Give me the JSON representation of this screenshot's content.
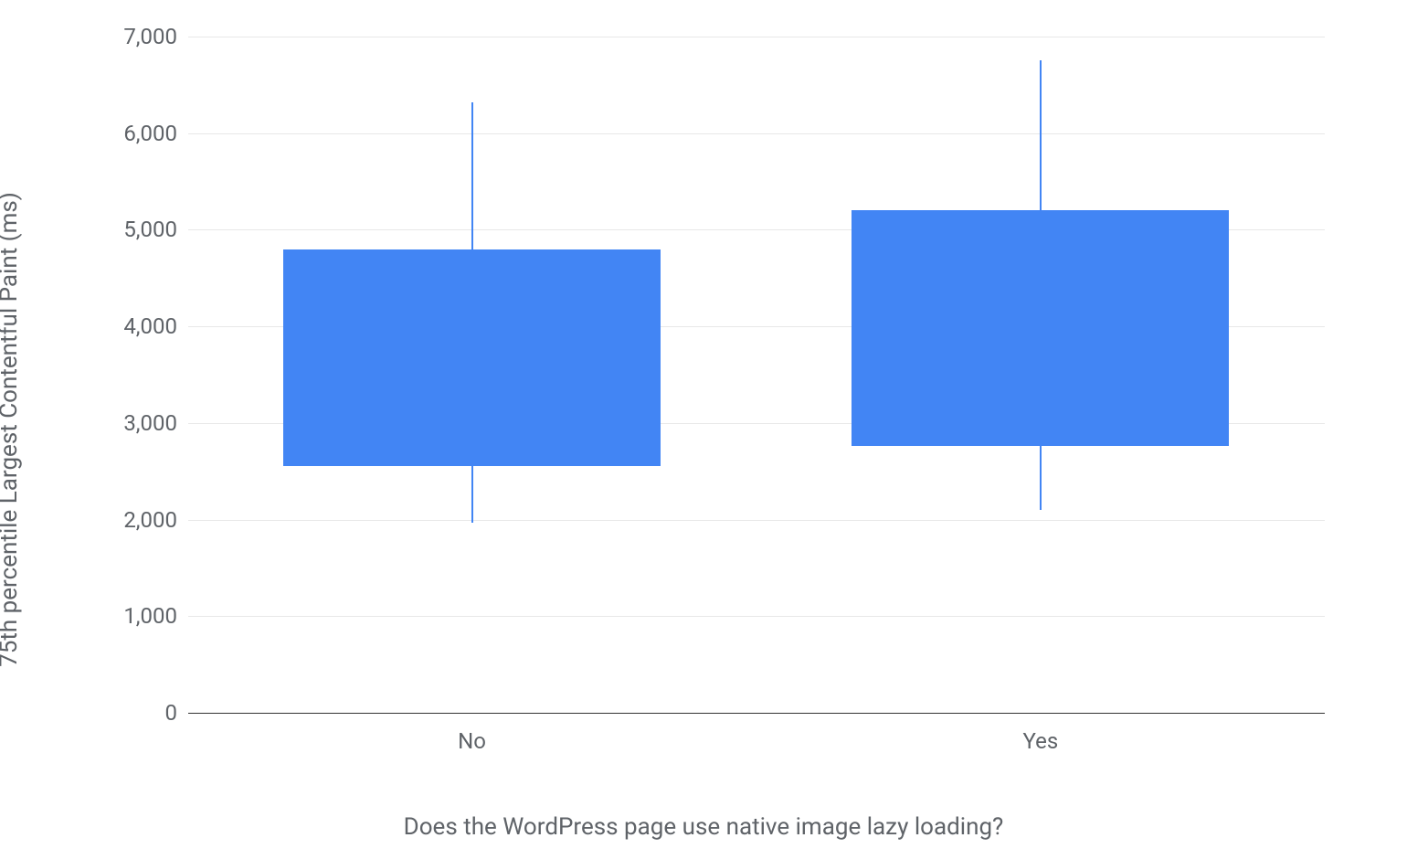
{
  "chart_data": {
    "type": "box",
    "xlabel": "Does the WordPress page use native image lazy loading?",
    "ylabel": "75th percentile Largest Contentful Paint (ms)",
    "ylim": [
      0,
      7000
    ],
    "y_ticks": [
      0,
      1000,
      2000,
      3000,
      4000,
      5000,
      6000,
      7000
    ],
    "y_tick_labels": [
      "0",
      "1,000",
      "2,000",
      "3,000",
      "4,000",
      "5,000",
      "6,000",
      "7,000"
    ],
    "categories": [
      "No",
      "Yes"
    ],
    "series": [
      {
        "name": "No",
        "low": 1970,
        "q1": 2550,
        "q3": 4800,
        "high": 6320
      },
      {
        "name": "Yes",
        "low": 2100,
        "q1": 2760,
        "q3": 5200,
        "high": 6750
      }
    ]
  }
}
